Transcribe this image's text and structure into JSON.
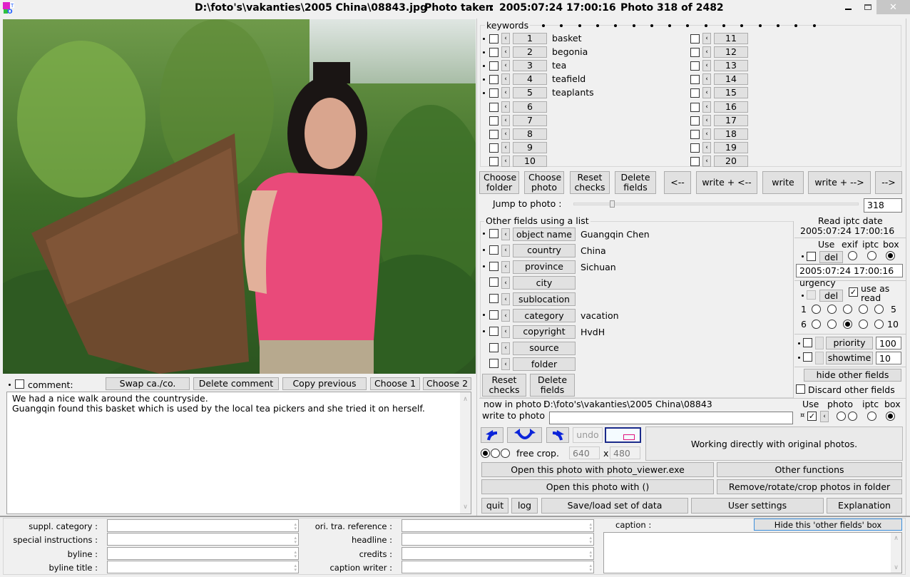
{
  "window": {
    "file_path": "D:\\foto's\\vakanties\\2005 China\\08843.jpg",
    "photo_taken_label": "Photo taken",
    "photo_taken": "2005:07:24 17:00:16",
    "photo_counter": "Photo 318 of 2482",
    "controls": {
      "minimize": "–",
      "maximize": "☐",
      "close": "✕"
    }
  },
  "colors": {
    "accent_blue": "#0b24d9",
    "crop_pink": "#e0127e",
    "close_bg": "#c7c7c7"
  },
  "keywords": {
    "label": "keywords",
    "left": [
      {
        "num": "1",
        "value": "basket",
        "marked": true
      },
      {
        "num": "2",
        "value": "begonia",
        "marked": true
      },
      {
        "num": "3",
        "value": "tea",
        "marked": true
      },
      {
        "num": "4",
        "value": "teafield",
        "marked": true
      },
      {
        "num": "5",
        "value": "teaplants",
        "marked": true
      },
      {
        "num": "6",
        "value": "",
        "marked": false
      },
      {
        "num": "7",
        "value": "",
        "marked": false
      },
      {
        "num": "8",
        "value": "",
        "marked": false
      },
      {
        "num": "9",
        "value": "",
        "marked": false
      },
      {
        "num": "10",
        "value": "",
        "marked": false
      }
    ],
    "right": [
      {
        "num": "11"
      },
      {
        "num": "12"
      },
      {
        "num": "13"
      },
      {
        "num": "14"
      },
      {
        "num": "15"
      },
      {
        "num": "16"
      },
      {
        "num": "17"
      },
      {
        "num": "18"
      },
      {
        "num": "19"
      },
      {
        "num": "20"
      }
    ]
  },
  "toolbar": {
    "choose_folder": "Choose folder",
    "choose_photo": "Choose photo",
    "reset_checks": "Reset checks",
    "delete_fields": "Delete fields",
    "prev": "<--",
    "write_prev": "write + <--",
    "write": "write",
    "write_next": "write + -->",
    "next": "-->"
  },
  "jump": {
    "label": "Jump to photo :",
    "value": "318",
    "slider_fraction": 0.128
  },
  "other_fields": {
    "label": "Other fields using a list",
    "items": [
      {
        "label": "object name",
        "value": "Guangqin Chen",
        "marked": true
      },
      {
        "label": "country",
        "value": "China",
        "marked": true
      },
      {
        "label": "province",
        "value": "Sichuan",
        "marked": true
      },
      {
        "label": "city",
        "value": "",
        "marked": false
      },
      {
        "label": "sublocation",
        "value": "",
        "marked": false
      },
      {
        "label": "category",
        "value": "vacation",
        "marked": true
      },
      {
        "label": "copyright",
        "value": "HvdH",
        "marked": true
      },
      {
        "label": "source",
        "value": "",
        "marked": false
      },
      {
        "label": "folder",
        "value": "",
        "marked": false
      }
    ],
    "reset_checks": "Reset checks",
    "delete_fields": "Delete fields"
  },
  "date_panel": {
    "read_label": "Read iptc date",
    "read_value": "2005:07:24 17:00:16",
    "use": "Use",
    "exif": "exif",
    "iptc": "iptc",
    "box": "box",
    "del": "del",
    "date_value": "2005:07:24 17:00:16",
    "urgency_label": "urgency",
    "use_as_read": "use as read",
    "row1_start": "1",
    "row1_end": "5",
    "row2_start": "6",
    "row2_end": "10",
    "urgency_selected": 8,
    "priority_label": "priority",
    "priority_value": "100",
    "showtime_label": "showtime",
    "showtime_value": "10",
    "hide_other": "hide other fields",
    "discard_other": "Discard other fields"
  },
  "now_in_photo": {
    "label": "now in photo :",
    "value": "D:\\foto's\\vakanties\\2005 China\\08843",
    "write_label": "write to photo",
    "write_value": "",
    "use": "Use",
    "photo": "photo",
    "iptc": "iptc",
    "box": "box",
    "marker": "¤"
  },
  "edit": {
    "undo": "undo",
    "free_crop": "free crop.",
    "width": "640",
    "x": "x",
    "height": "480",
    "status": "Working directly with original photos."
  },
  "actions": {
    "open_viewer": "Open this photo with photo_viewer.exe",
    "other_functions": "Other functions",
    "open_with": "Open this photo with ()",
    "remove_rotate": "Remove/rotate/crop photos in folder",
    "quit": "quit",
    "log": "log",
    "save_load": "Save/load set of data",
    "user_settings": "User settings",
    "explanation": "Explanation"
  },
  "comment": {
    "label": "comment:",
    "swap": "Swap ca./co.",
    "delete": "Delete comment",
    "copy_previous": "Copy previous",
    "choose1": "Choose 1",
    "choose2": "Choose 2",
    "line1": "We had a nice walk around the countryside.",
    "line2": "Guangqin found this basket which is used by the local tea pickers and she tried it on herself."
  },
  "bottom": {
    "left_labels": [
      "suppl. category :",
      "special instructions :",
      "byline :",
      "byline title :"
    ],
    "mid_labels": [
      "ori. tra. reference :",
      "headline :",
      "credits :",
      "caption writer :"
    ],
    "caption_label": "caption :",
    "hide_box": "Hide this 'other fields' box"
  }
}
